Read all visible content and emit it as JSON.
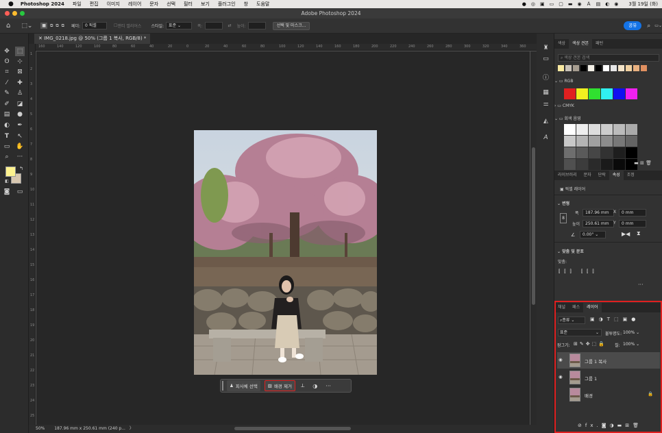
{
  "menubar": {
    "app": "Photoshop 2024",
    "items": [
      "파일",
      "편집",
      "이미지",
      "레이어",
      "문자",
      "선택",
      "필터",
      "보기",
      "플러그인",
      "창",
      "도움말"
    ],
    "clock": "3월 19일 (화)"
  },
  "window": {
    "title": "Adobe Photoshop 2024"
  },
  "options": {
    "feather_label": "페더:",
    "feather_value": "0 픽셀",
    "antialias": "앤티 앨리어스",
    "style_label": "스타일:",
    "style_value": "표준",
    "width_label": "폭:",
    "height_label": "높이:",
    "select_mask": "선택 및 마스크...",
    "share": "공유"
  },
  "doc": {
    "tab_title": "IMG_0218.jpg @ 50% (그룹 1 복사, RGB/8) *"
  },
  "ruler": {
    "h": [
      "160",
      "140",
      "120",
      "100",
      "80",
      "60",
      "40",
      "20",
      "0",
      "20",
      "40",
      "60",
      "80",
      "100",
      "120",
      "140",
      "160",
      "180",
      "200",
      "220",
      "240",
      "260",
      "280",
      "300",
      "320",
      "340",
      "360"
    ],
    "v": [
      "1",
      "2",
      "3",
      "4",
      "5",
      "6",
      "7",
      "8",
      "9",
      "10",
      "11",
      "12",
      "13",
      "14",
      "15",
      "16",
      "17",
      "18",
      "19",
      "20",
      "21",
      "22",
      "23",
      "24",
      "25"
    ]
  },
  "status": {
    "zoom": "50%",
    "info": "187.96 mm x 250.61 mm (240 p...",
    "arrow": "〉"
  },
  "contextbar": {
    "select_subject": "피사체 선택",
    "remove_bg": "배경 제거",
    "more": "···"
  },
  "swatches_panel": {
    "tabs": [
      "색상",
      "색상 견본",
      "패턴"
    ],
    "search_placeholder": "색상 견본 검색",
    "recent": [
      "#f8e9a0",
      "#c9c2b8",
      "#a69d90",
      "#000000",
      "#f2efe6",
      "#000000",
      "#ffffff",
      "#e6e6e6",
      "#f3e3c8",
      "#f0d0a0",
      "#e8b080",
      "#e09060"
    ],
    "group_rgb": "RGB",
    "rgb": [
      "#e02020",
      "#f0f020",
      "#30e030",
      "#30f0f0",
      "#1010f0",
      "#f020f0"
    ],
    "group_cmyk": "CMYK",
    "group_gray": "회색 음영",
    "grays": [
      "#ffffff",
      "#eeeeee",
      "#dddddd",
      "#cccccc",
      "#bbbbbb",
      "#aaaaaa",
      "#c8c8c8",
      "#b4b4b4",
      "#a0a0a0",
      "#8c8c8c",
      "#787878",
      "#646464",
      "#6e6e6e",
      "#5a5a5a",
      "#464646",
      "#323232",
      "#1e1e1e",
      "#000000",
      "#505050",
      "#3c3c3c",
      "#2a2a2a",
      "#1a1a1a",
      "#0a0a0a",
      "#000000"
    ]
  },
  "props_panel": {
    "tabs": [
      "라이브러리",
      "문자",
      "단락",
      "속성",
      "조정"
    ],
    "layer_type": "픽셀 레이어",
    "transform": "변형",
    "w_label": "폭",
    "w_value": "187.96 mm",
    "x_label": "X",
    "x_value": "0 mm",
    "h_label": "높이",
    "h_value": "250.61 mm",
    "y_label": "Y",
    "y_value": "0 mm",
    "angle": "0.00°",
    "align": "맞춤 및 분포",
    "align_sub": "맞춤:",
    "more": "···"
  },
  "layers_panel": {
    "tabs": [
      "채널",
      "패스",
      "레이어"
    ],
    "filter": "종류",
    "blend": "표준",
    "opacity_label": "불투명도:",
    "opacity": "100%",
    "lock_label": "잠그기:",
    "fill_label": "칠:",
    "fill": "100%",
    "layers": [
      {
        "name": "그룹 1 복사",
        "visible": true,
        "selected": true
      },
      {
        "name": "그룹 1",
        "visible": true,
        "selected": false
      },
      {
        "name": "배경",
        "visible": false,
        "selected": false,
        "locked": true
      }
    ],
    "fx": "fx."
  }
}
